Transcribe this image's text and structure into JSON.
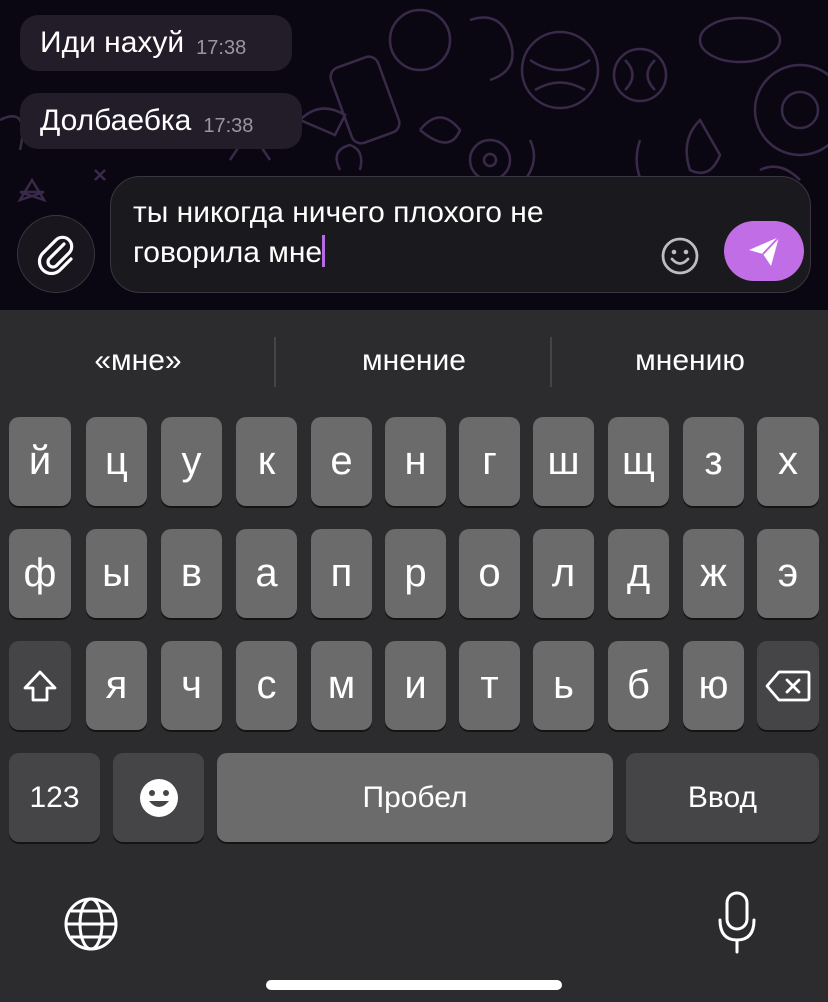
{
  "messages": [
    {
      "text": "Иди нахуй",
      "time": "17:38"
    },
    {
      "text": "Долбаебка",
      "time": "17:38"
    }
  ],
  "composer": {
    "text_line1": "ты никогда ничего плохого не",
    "text_line2": "говорила мне",
    "attach_icon": "paperclip-icon",
    "emoji_icon": "smiley-icon",
    "send_icon": "paper-plane-icon",
    "accent_color": "#c06de6"
  },
  "keyboard": {
    "suggestions": [
      "«мне»",
      "мнение",
      "мнению"
    ],
    "row1": [
      "й",
      "ц",
      "у",
      "к",
      "е",
      "н",
      "г",
      "ш",
      "щ",
      "з",
      "х"
    ],
    "row2": [
      "ф",
      "ы",
      "в",
      "а",
      "п",
      "р",
      "о",
      "л",
      "д",
      "ж",
      "э"
    ],
    "row3": [
      "я",
      "ч",
      "с",
      "м",
      "и",
      "т",
      "ь",
      "б",
      "ю"
    ],
    "shift_icon": "shift-arrow-icon",
    "backspace_icon": "backspace-icon",
    "numbers_label": "123",
    "emoji_icon": "emoji-face-icon",
    "space_label": "Пробел",
    "return_label": "Ввод",
    "globe_icon": "globe-icon",
    "mic_icon": "microphone-icon"
  }
}
